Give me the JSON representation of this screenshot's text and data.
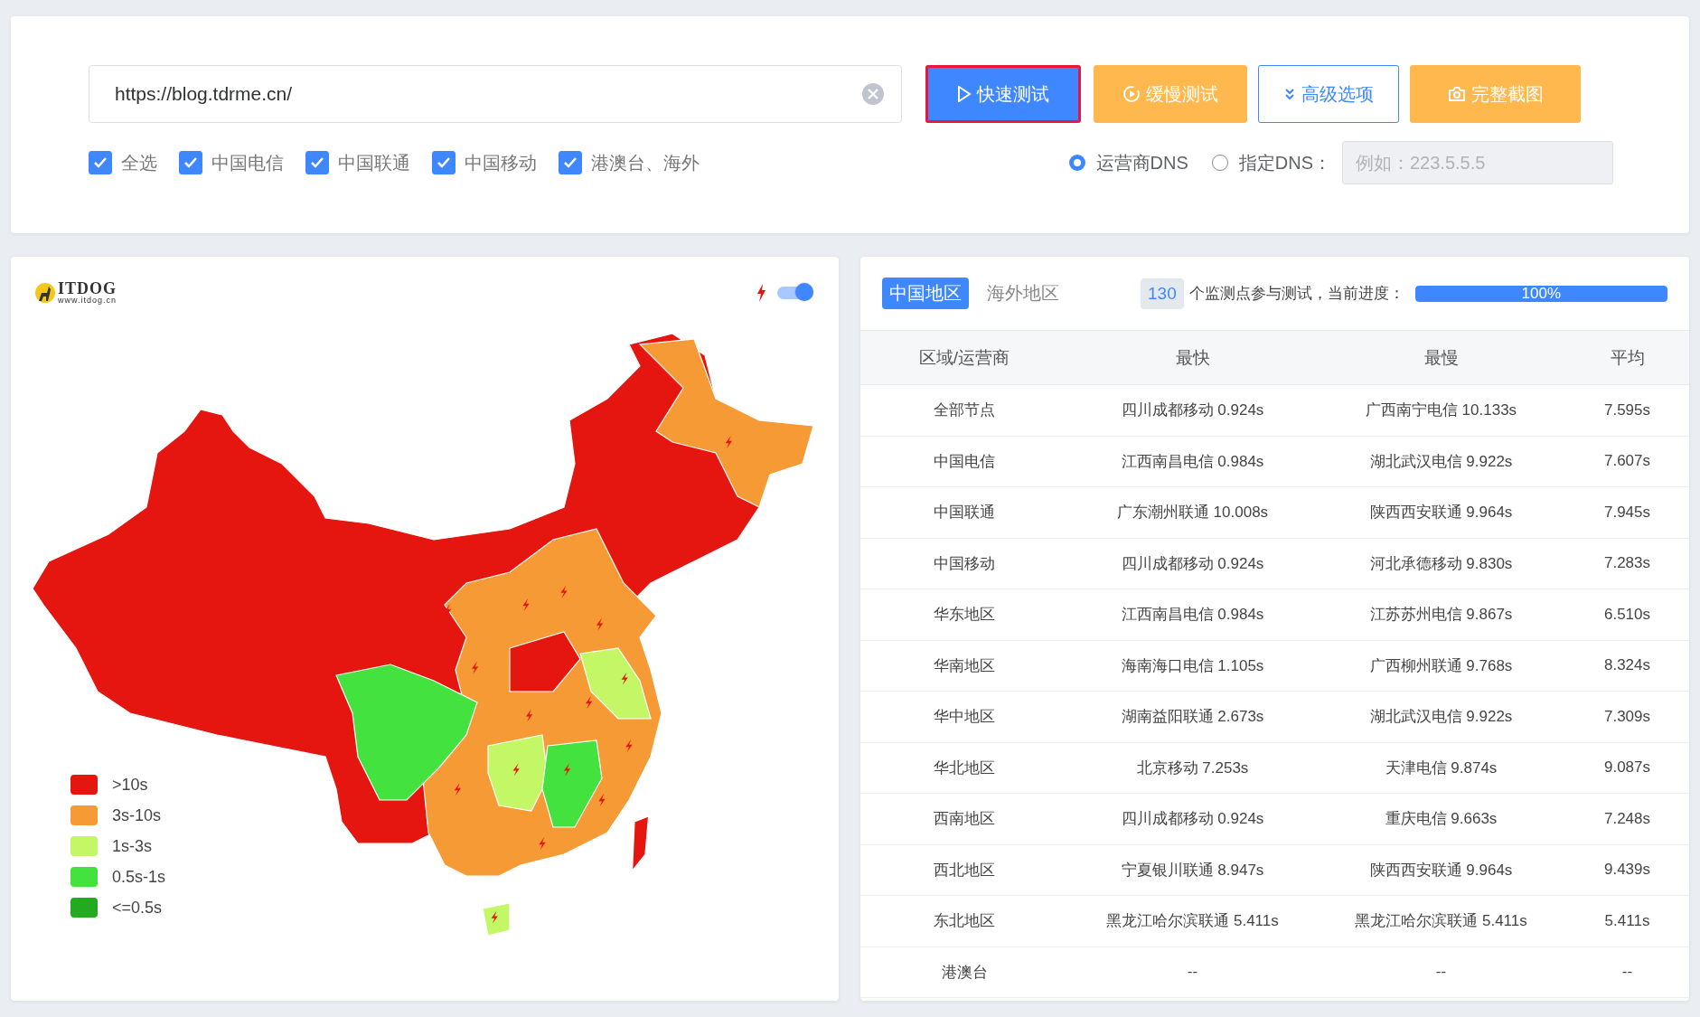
{
  "url_field": {
    "value": "https://blog.tdrme.cn/"
  },
  "buttons": [
    {
      "label": "快速测试",
      "kind": "fast"
    },
    {
      "label": "缓慢测试",
      "kind": "slow"
    },
    {
      "label": "高级选项",
      "kind": "advanced"
    },
    {
      "label": "完整截图",
      "kind": "screenshot"
    }
  ],
  "carriers": [
    {
      "label": "全选",
      "checked": true
    },
    {
      "label": "中国电信",
      "checked": true
    },
    {
      "label": "中国联通",
      "checked": true
    },
    {
      "label": "中国移动",
      "checked": true
    },
    {
      "label": "港澳台、海外",
      "checked": true
    }
  ],
  "dns_options": [
    {
      "label": "运营商DNS",
      "selected": true
    },
    {
      "label": "指定DNS：",
      "selected": false
    }
  ],
  "dns_field": {
    "placeholder": "例如：223.5.5.5"
  },
  "map_panel": {
    "logo_title": "ITDOG",
    "logo_url": "www.itdog.cn",
    "lightning_toggle": {
      "on": true
    },
    "legend": [
      {
        "label": ">10s",
        "color": "#e5150f"
      },
      {
        "label": "3s-10s",
        "color": "#f69a35"
      },
      {
        "label": "1s-3s",
        "color": "#c3f766"
      },
      {
        "label": "0.5s-1s",
        "color": "#43e23f"
      },
      {
        "label": "<=0.5s",
        "color": "#24aa21"
      }
    ]
  },
  "results": {
    "tabs": [
      {
        "label": "中国地区",
        "selected": true
      },
      {
        "label": "海外地区",
        "selected": false
      }
    ],
    "node_count": "130",
    "progress_text": "个监测点参与测试，当前进度：",
    "progress": {
      "level": 1,
      "reading": "100%"
    },
    "columns": [
      "区域/运营商",
      "最快",
      "最慢",
      "平均"
    ],
    "rows": [
      [
        "全部节点",
        "四川成都移动 0.924s",
        "广西南宁电信 10.133s",
        "7.595s"
      ],
      [
        "中国电信",
        "江西南昌电信 0.984s",
        "湖北武汉电信 9.922s",
        "7.607s"
      ],
      [
        "中国联通",
        "广东潮州联通 10.008s",
        "陕西西安联通 9.964s",
        "7.945s"
      ],
      [
        "中国移动",
        "四川成都移动 0.924s",
        "河北承德移动 9.830s",
        "7.283s"
      ],
      [
        "华东地区",
        "江西南昌电信 0.984s",
        "江苏苏州电信 9.867s",
        "6.510s"
      ],
      [
        "华南地区",
        "海南海口电信 1.105s",
        "广西柳州联通 9.768s",
        "8.324s"
      ],
      [
        "华中地区",
        "湖南益阳联通 2.673s",
        "湖北武汉电信 9.922s",
        "7.309s"
      ],
      [
        "华北地区",
        "北京移动 7.253s",
        "天津电信 9.874s",
        "9.087s"
      ],
      [
        "西南地区",
        "四川成都移动 0.924s",
        "重庆电信 9.663s",
        "7.248s"
      ],
      [
        "西北地区",
        "宁夏银川联通 8.947s",
        "陕西西安联通 9.964s",
        "9.439s"
      ],
      [
        "东北地区",
        "黑龙江哈尔滨联通 5.411s",
        "黑龙江哈尔滨联通 5.411s",
        "5.411s"
      ],
      [
        "港澳台",
        "--",
        "--",
        "--"
      ]
    ]
  }
}
